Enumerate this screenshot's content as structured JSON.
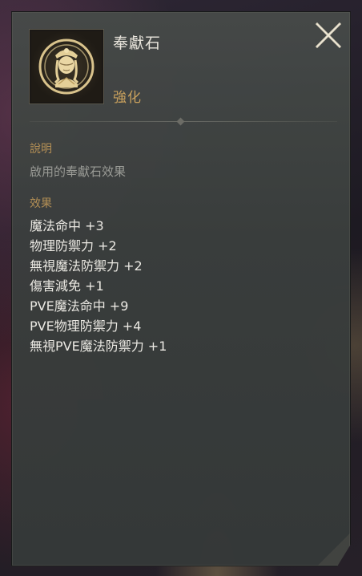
{
  "item": {
    "name": "奉獻石",
    "type": "強化",
    "icon": "goddess-statue-icon"
  },
  "close_icon": "close-x-icon",
  "description": {
    "label": "說明",
    "text": "啟用的奉獻石效果"
  },
  "effects": {
    "label": "效果",
    "items": [
      "魔法命中 +3",
      "物理防禦力 +2",
      "無視魔法防禦力 +2",
      "傷害減免 +1",
      "PVE魔法命中 +9",
      "PVE物理防禦力 +4",
      "無視PVE魔法防禦力 +1"
    ]
  },
  "colors": {
    "title": "#e9e5dc",
    "accent_gold": "#c9a15d",
    "section_label": "#b48f55",
    "muted_text": "#9a9b96",
    "panel_bg": "#3a3e3d"
  }
}
